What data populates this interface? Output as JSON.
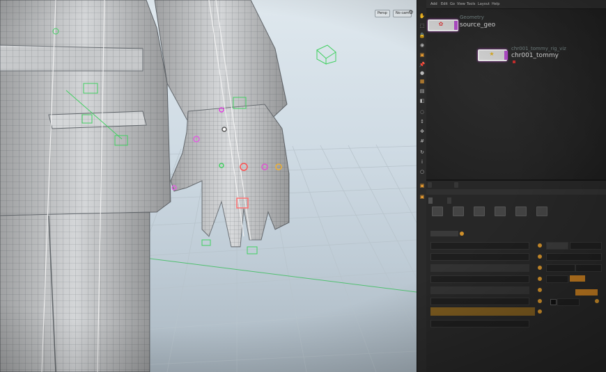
{
  "viewport": {
    "persp_label": "Persp",
    "cam_label": "No cam"
  },
  "menu": {
    "items": [
      "Add",
      "Edit",
      "Go",
      "View",
      "Tools",
      "Layout",
      "Help"
    ]
  },
  "network": {
    "node1": {
      "category": "Geometry",
      "name": "source_geo"
    },
    "node2": {
      "category": "chr001_tommy_rig_viz",
      "name": "chr001_tommy"
    }
  },
  "colors": {
    "accent": "#f0a030",
    "node_flag": "#b84fd0",
    "highlight_row": "#7b5a1f"
  },
  "icons": [
    "hand-tool-icon",
    "select-icon",
    "lock-icon",
    "camera-icon",
    "pin-icon"
  ]
}
